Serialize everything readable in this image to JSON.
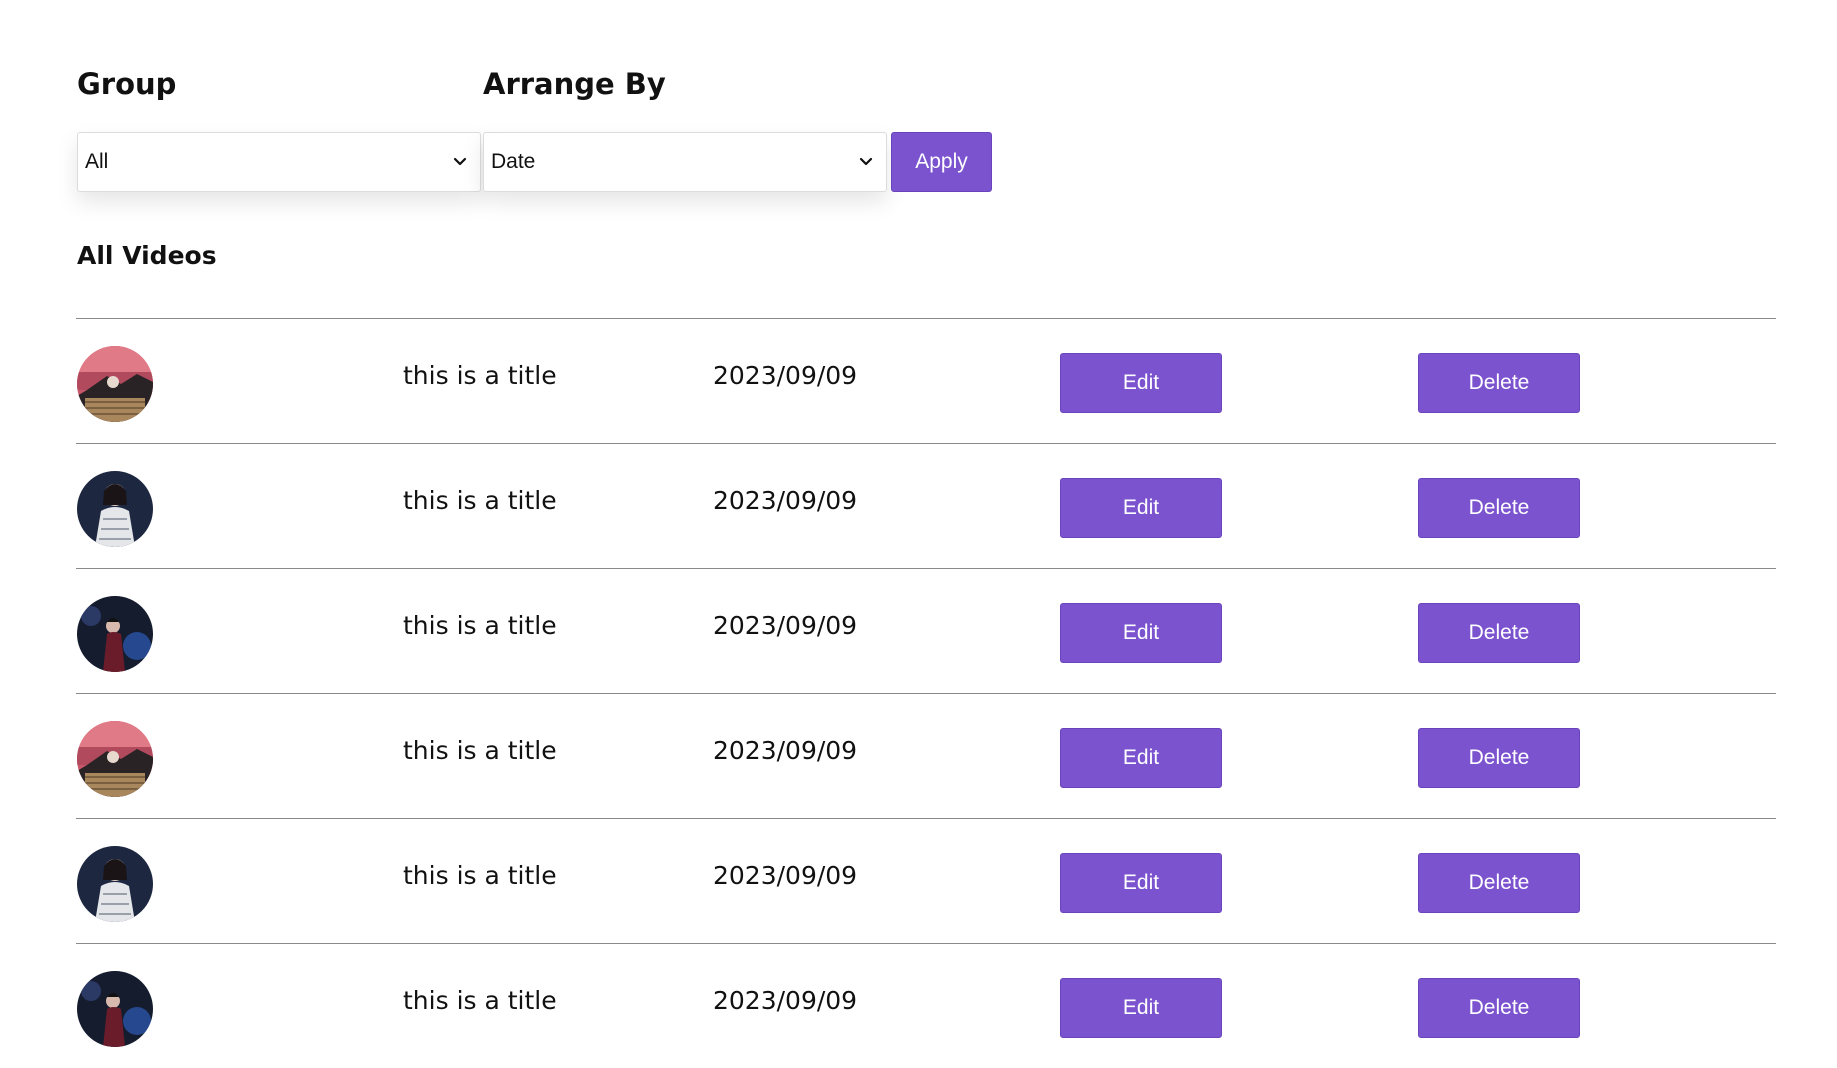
{
  "filters": {
    "group": {
      "label": "Group",
      "selected": "All"
    },
    "arrange": {
      "label": "Arrange By",
      "selected": "Date"
    },
    "apply_label": "Apply"
  },
  "section": {
    "title": "All Videos"
  },
  "colors": {
    "accent": "#7b53cf",
    "button_text": "#ffffff",
    "divider": "#8a8a8a"
  },
  "videos": [
    {
      "thumbnail": "pink-sky-scene",
      "title": "this is a title",
      "date": "2023/09/09",
      "edit_label": "Edit",
      "delete_label": "Delete"
    },
    {
      "thumbnail": "woman-white-dress",
      "title": "this is a title",
      "date": "2023/09/09",
      "edit_label": "Edit",
      "delete_label": "Delete"
    },
    {
      "thumbnail": "blue-stage-performer",
      "title": "this is a title",
      "date": "2023/09/09",
      "edit_label": "Edit",
      "delete_label": "Delete"
    },
    {
      "thumbnail": "pink-sky-scene",
      "title": "this is a title",
      "date": "2023/09/09",
      "edit_label": "Edit",
      "delete_label": "Delete"
    },
    {
      "thumbnail": "woman-white-dress",
      "title": "this is a title",
      "date": "2023/09/09",
      "edit_label": "Edit",
      "delete_label": "Delete"
    },
    {
      "thumbnail": "blue-stage-performer",
      "title": "this is a title",
      "date": "2023/09/09",
      "edit_label": "Edit",
      "delete_label": "Delete"
    }
  ]
}
